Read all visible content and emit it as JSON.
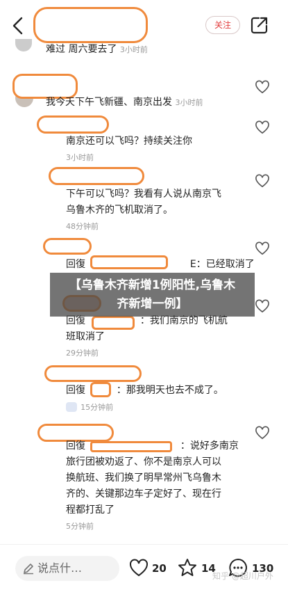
{
  "header": {
    "follow_label": "关注"
  },
  "comments": [
    {
      "text": "难过 周六要去了",
      "time": "3小时前"
    },
    {
      "text": "我今天下午飞新疆、南京出发",
      "time": "3小时前"
    },
    {
      "text": "南京还可以飞吗？持续关注你",
      "time": "3小时前"
    },
    {
      "text_l1": "下午可以飞吗？我看有人说从南京飞",
      "text_l2": "乌鲁木齐的飞机取消了。",
      "time": "48分钟前"
    },
    {
      "prefix": "回復",
      "suffix": "E：已经取消了"
    },
    {
      "prefix": "回復",
      "text_l1": "：我们南京的飞机航",
      "text_l2": "班取消了",
      "time": "29分钟前"
    },
    {
      "prefix": "回復",
      "text": "：那我明天也去不成了。",
      "time": "15分钟前"
    },
    {
      "prefix": "回復",
      "text_l1": "：说好多南京",
      "text_l2": "旅行团被劝返了、你不是南京人可以",
      "text_l3": "换航班、我们换了明早常州飞乌鲁木",
      "text_l4": "齐的、关键那边车子定好了、现在行",
      "text_l5": "程都打乱了",
      "time": "5分钟前"
    }
  ],
  "banner": {
    "line1": "【乌鲁木齐新增1例阳性,乌鲁木",
    "line2": "齐新增一例】"
  },
  "bottom_bar": {
    "input_placeholder": "说点什…",
    "likes": "20",
    "favorites": "14",
    "comments": "130",
    "watermark": "知乎 @超川户外"
  }
}
